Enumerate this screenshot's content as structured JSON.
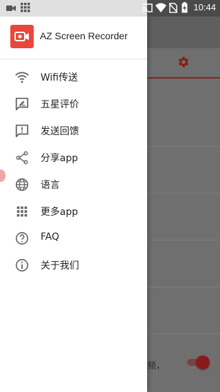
{
  "status_bar": {
    "time": "10:44",
    "left_icons": [
      "video-camera-icon",
      "grid-icon"
    ],
    "right_icons": [
      "cast-icon",
      "wifi-icon",
      "no-sim-icon",
      "battery-charging-icon"
    ]
  },
  "drawer": {
    "app_title": "AZ Screen Recorder",
    "logo_color": "#e8483c",
    "items": [
      {
        "label": "Wifi传送",
        "icon": "wifi-icon"
      },
      {
        "label": "五星评价",
        "icon": "rate-icon"
      },
      {
        "label": "发送回馈",
        "icon": "feedback-icon"
      },
      {
        "label": "分享app",
        "icon": "share-icon"
      },
      {
        "label": "语言",
        "icon": "globe-icon"
      },
      {
        "label": "更多app",
        "icon": "apps-grid-icon"
      },
      {
        "label": "FAQ",
        "icon": "help-icon"
      },
      {
        "label": "关于我们",
        "icon": "info-icon"
      }
    ]
  },
  "background": {
    "partial_text": "频，",
    "accent_color": "#8a1a1a",
    "toggle_on": true
  }
}
